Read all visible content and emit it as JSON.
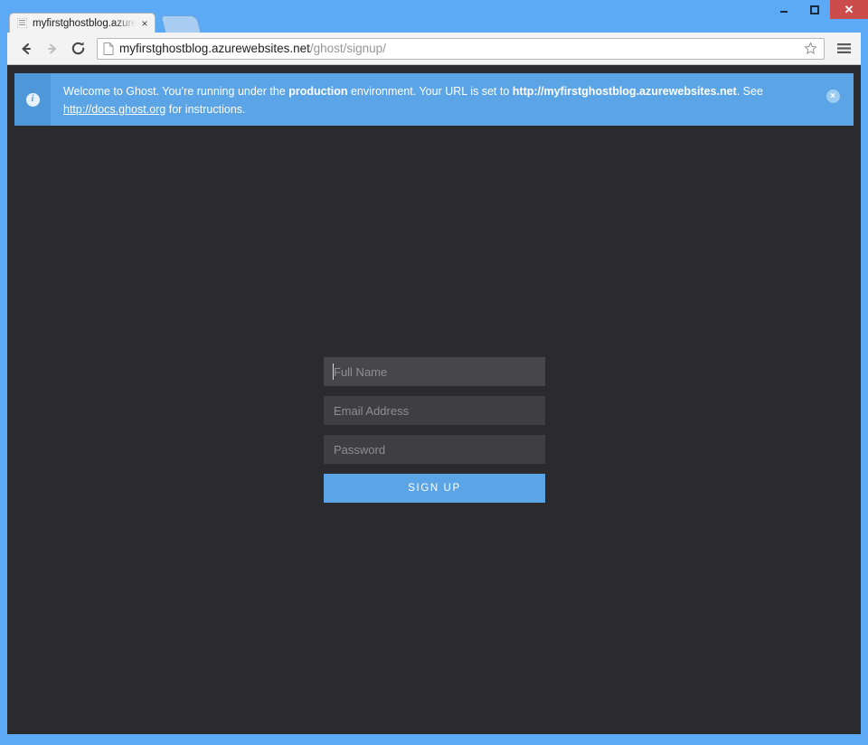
{
  "window": {
    "controls": {
      "minimize_label": "Minimize",
      "maximize_label": "Maximize",
      "close_label": "✕"
    },
    "frame_color": "#5ca9f5"
  },
  "browser": {
    "tab": {
      "title": "myfirstghostblog.azurewe",
      "close_label": "×",
      "favicon_name": "page-lines-favicon"
    },
    "new_tab_label": "",
    "toolbar": {
      "back_label": "←",
      "forward_label": "→",
      "reload_label": "⟳",
      "star_label": "☆",
      "menu_label": "≡"
    },
    "omnibox": {
      "domain": "myfirstghostblog.azurewebsites.net",
      "path": "/ghost/signup/"
    }
  },
  "notification": {
    "icon": "info-icon",
    "text_part1": "Welcome to Ghost. You’re running under the ",
    "bold_environment": "production",
    "text_part2": " environment. Your URL is set to ",
    "bold_url": "http://myfirstghostblog.azurewebsites.net",
    "text_part3": ". See ",
    "link_text": "http://docs.ghost.org",
    "text_part4": " for instructions.",
    "close_label": "×",
    "background_color": "#5ba4e5",
    "icon_background_color": "#4e97d9"
  },
  "signup": {
    "fields": [
      {
        "name": "full-name",
        "placeholder": "Full Name",
        "value": "",
        "focused": true
      },
      {
        "name": "email-address",
        "placeholder": "Email Address",
        "value": "",
        "focused": false
      },
      {
        "name": "password",
        "placeholder": "Password",
        "value": "",
        "focused": false
      }
    ],
    "submit_label": "Sign Up",
    "accent_color": "#5ba4e5",
    "field_background": "#3f3f42",
    "page_background": "#2b2b2d"
  }
}
